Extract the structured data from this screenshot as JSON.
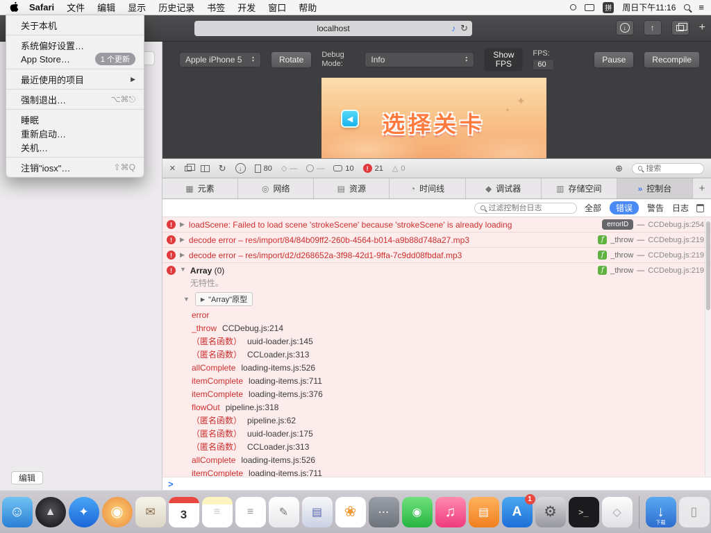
{
  "menubar": {
    "items": [
      {
        "id": "safari",
        "label": "Safari",
        "bold": true
      },
      {
        "id": "file",
        "label": "文件"
      },
      {
        "id": "edit",
        "label": "编辑"
      },
      {
        "id": "view",
        "label": "显示"
      },
      {
        "id": "history",
        "label": "历史记录"
      },
      {
        "id": "bookmarks",
        "label": "书签"
      },
      {
        "id": "develop",
        "label": "开发"
      },
      {
        "id": "window",
        "label": "窗口"
      },
      {
        "id": "help",
        "label": "帮助"
      }
    ],
    "input_badge": "拼",
    "time": "周日下午11:16"
  },
  "apple_menu": {
    "items": [
      {
        "id": "about",
        "label": "关于本机"
      },
      {
        "sep": true
      },
      {
        "id": "system-preferences",
        "label": "系统偏好设置…"
      },
      {
        "id": "app-store",
        "label": "App Store…",
        "badge": "1 个更新"
      },
      {
        "sep": true
      },
      {
        "id": "recent-items",
        "label": "最近使用的项目",
        "submenu": true
      },
      {
        "sep": true
      },
      {
        "id": "force-quit",
        "label": "强制退出…",
        "shortcut": "⌥⌘⎋"
      },
      {
        "sep": true
      },
      {
        "id": "sleep",
        "label": "睡眠"
      },
      {
        "id": "restart",
        "label": "重新启动…"
      },
      {
        "id": "shut-down",
        "label": "关机…"
      },
      {
        "sep": true
      },
      {
        "id": "log-out",
        "label": "注销\"iosx\"…",
        "shortcut": "⇧⌘Q"
      }
    ]
  },
  "safari": {
    "address": "localhost"
  },
  "sidebar": {
    "edit_label": "编辑"
  },
  "device": {
    "device_name": "Apple iPhone 5",
    "rotate": "Rotate",
    "debug_label": "Debug Mode:",
    "info": "Info",
    "show_fps": "Show FPS",
    "fps_label": "FPS:",
    "fps_value": "60",
    "pause": "Pause",
    "recompile": "Recompile"
  },
  "game": {
    "title": "选择关卡"
  },
  "inspector": {
    "toolbar": {
      "doc_count": "80",
      "dash": "—",
      "msg_count": "10",
      "err_count": "21",
      "warn_count": "0",
      "search_placeholder": "搜索"
    },
    "tabs": [
      {
        "id": "elements",
        "label": "元素",
        "icon": "▦"
      },
      {
        "id": "network",
        "label": "网络",
        "icon": "◎"
      },
      {
        "id": "resources",
        "label": "资源",
        "icon": "▤"
      },
      {
        "id": "timelines",
        "label": "时间线",
        "icon": "◔"
      },
      {
        "id": "debugger",
        "label": "调试器",
        "icon": "◆"
      },
      {
        "id": "storage",
        "label": "存储空间",
        "icon": "▥"
      },
      {
        "id": "console",
        "label": "控制台",
        "icon": "»"
      }
    ],
    "active_tab": "控制台",
    "add_tab": "+"
  },
  "console": {
    "filter_placeholder": "过滤控制台日志",
    "scopes": [
      "全部",
      "错误",
      "警告",
      "日志"
    ],
    "active_scope": "错误",
    "meta_separator": "—",
    "entries": [
      {
        "text": "loadScene: Failed to load scene 'strokeScene' because 'strokeScene' is already loading",
        "badge_dark": "errorID",
        "source": "CCDebug.js:254"
      },
      {
        "text": "decode error – res/import/84/84b09ff2-260b-4564-b014-a9b88d748a27.mp3",
        "badge_f": "f",
        "fn": "_throw",
        "source": "CCDebug.js:219"
      },
      {
        "text": "decode error – res/import/d2/d268652a-3f98-42d1-9ffa-7c9dd08fbdaf.mp3",
        "badge_f": "f",
        "fn": "_throw",
        "source": "CCDebug.js:219"
      },
      {
        "type": "object",
        "expanded": true,
        "title": "Array",
        "count": "(0)",
        "subtitle": "无特性。",
        "badge_f": "f",
        "fn": "_throw",
        "source": "CCDebug.js:219"
      }
    ],
    "proto_label": "\"Array\"原型",
    "stack": [
      {
        "fn": "error",
        "loc": ""
      },
      {
        "fn": "_throw",
        "loc": "CCDebug.js:214"
      },
      {
        "fn": "（匿名函数）",
        "loc": "uuid-loader.js:145"
      },
      {
        "fn": "（匿名函数）",
        "loc": "CCLoader.js:313"
      },
      {
        "fn": "allComplete",
        "loc": "loading-items.js:526"
      },
      {
        "fn": "itemComplete",
        "loc": "loading-items.js:711"
      },
      {
        "fn": "itemComplete",
        "loc": "loading-items.js:376"
      },
      {
        "fn": "flowOut",
        "loc": "pipeline.js:318"
      },
      {
        "fn": "（匿名函数）",
        "loc": "pipeline.js:62"
      },
      {
        "fn": "（匿名函数）",
        "loc": "uuid-loader.js:175"
      },
      {
        "fn": "（匿名函数）",
        "loc": "CCLoader.js:313"
      },
      {
        "fn": "allComplete",
        "loc": "loading-items.js:526"
      },
      {
        "fn": "itemComplete",
        "loc": "loading-items.js:711"
      }
    ],
    "prompt": ">"
  },
  "icons": {
    "bang": "!",
    "tri_right": "▶",
    "tri_down": "▼",
    "close": "×",
    "reload": "↻",
    "down_arrow": "↓",
    "up_arrow": "↑",
    "diamond": "◇",
    "warning": "△",
    "target": "⊕",
    "plus": "+",
    "speaker": "♪",
    "menu_lines": "≡",
    "tri_up_small": "▲",
    "tri_down_small": "▼",
    "back": "◀",
    "star": "✦"
  },
  "dock": {
    "items": [
      {
        "id": "finder",
        "glyph": "☺"
      },
      {
        "id": "launchpad",
        "glyph": "▲"
      },
      {
        "id": "safari",
        "glyph": "✦"
      },
      {
        "id": "maps",
        "glyph": "◉"
      },
      {
        "id": "mail",
        "glyph": "✉"
      },
      {
        "id": "calendar",
        "glyph": "3"
      },
      {
        "id": "notes",
        "glyph": "≡"
      },
      {
        "id": "reminders",
        "glyph": "≡"
      },
      {
        "id": "textedit",
        "glyph": "✎"
      },
      {
        "id": "dictionary",
        "glyph": "▤"
      },
      {
        "id": "photos",
        "glyph": "❀"
      },
      {
        "id": "messages",
        "glyph": "⋯"
      },
      {
        "id": "facetime",
        "glyph": "◉"
      },
      {
        "id": "music",
        "glyph": "♫"
      },
      {
        "id": "books",
        "glyph": "▤"
      },
      {
        "id": "appstore",
        "glyph": "A",
        "badge": "1"
      },
      {
        "id": "system-preferences",
        "glyph": "⚙"
      },
      {
        "id": "terminal",
        "glyph": ">_"
      },
      {
        "id": "app-generic",
        "glyph": "◇"
      },
      {
        "divider": true
      },
      {
        "id": "downloads",
        "glyph": "↓",
        "label": "下载"
      },
      {
        "id": "trash",
        "glyph": "▯"
      }
    ]
  }
}
